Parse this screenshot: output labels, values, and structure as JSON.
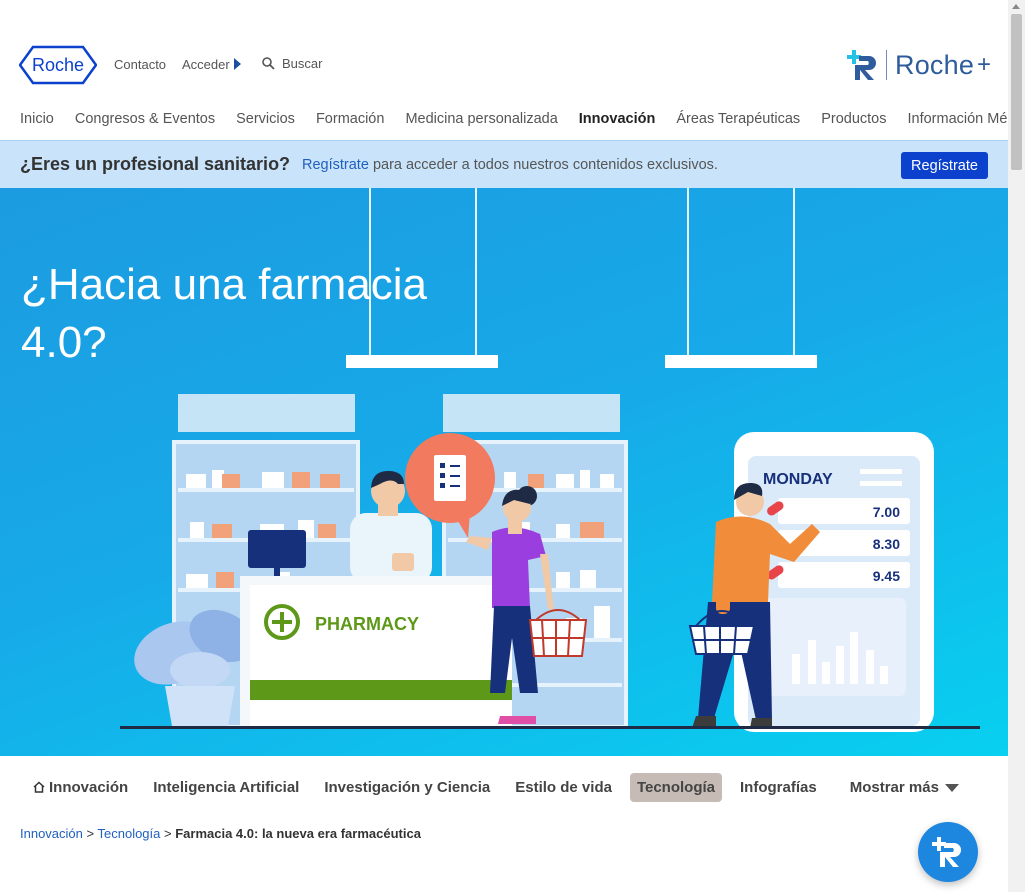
{
  "header": {
    "logo_text": "Roche",
    "util": {
      "contact": "Contacto",
      "login": "Acceder",
      "search": "Buscar"
    },
    "rocheplus": {
      "text": "Roche",
      "plus": "+"
    }
  },
  "nav": {
    "items": [
      "Inicio",
      "Congresos & Eventos",
      "Servicios",
      "Formación",
      "Medicina personalizada",
      "Innovación",
      "Áreas Terapéuticas",
      "Productos",
      "Información Médica"
    ],
    "active": "Innovación"
  },
  "banner": {
    "question": "¿Eres un profesional sanitario?",
    "link": "Regístrate",
    "text": "para acceder a todos nuestros contenidos exclusivos.",
    "button": "Regístrate"
  },
  "hero": {
    "title_line1": "¿Hacia una farmacia",
    "title_line2": "4.0?",
    "illustration": {
      "pharmacy_sign": "PHARMACY",
      "day": "MONDAY",
      "times": [
        "7.00",
        "8.30",
        "9.45"
      ]
    }
  },
  "subnav": {
    "home": "Innovación",
    "items": [
      "Inteligencia Artificial",
      "Investigación y Ciencia",
      "Estilo de vida",
      "Tecnología",
      "Infografías"
    ],
    "selected": "Tecnología",
    "more": "Mostrar más"
  },
  "breadcrumb": {
    "items": [
      "Innovación",
      "Tecnología"
    ],
    "separator": ">",
    "current": "Farmacia 4.0: la nueva era farmacéutica"
  },
  "colors": {
    "brand_blue": "#0b41cd",
    "banner_bg": "#c9e4fa",
    "hero_start": "#1c9be0",
    "hero_end": "#08d0f0",
    "fab": "#1d86df"
  }
}
